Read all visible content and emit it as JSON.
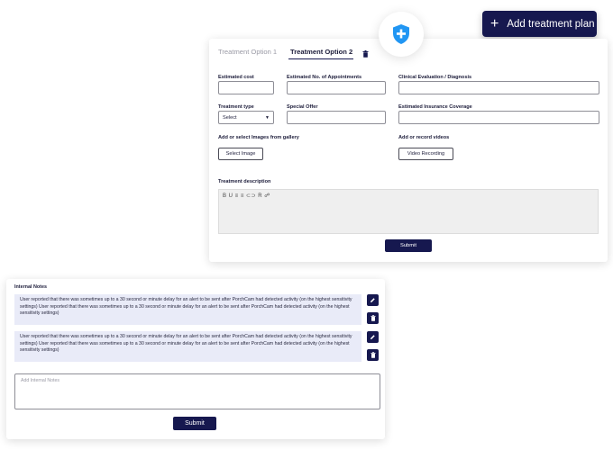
{
  "header": {
    "add_plan_label": "Add treatment plan"
  },
  "tabs": [
    {
      "label": "Treatment Option 1"
    },
    {
      "label": "Treatment Option 2"
    }
  ],
  "form": {
    "estimated_cost_label": "Estimated cost",
    "appointments_label": "Estimated No. of Appointments",
    "clinical_label": "Clinical Evaluation / Diagnosis",
    "treatment_type_label": "Treatment type",
    "treatment_type_value": "Select",
    "special_offer_label": "Special Offer",
    "insurance_label": "Estimated Insurance Coverage",
    "images_label": "Add or select Images from gallery",
    "select_image_button": "Select Image",
    "videos_label": "Add or record videos",
    "video_button": "Video Recording",
    "description_label": "Treatment description",
    "toolbar_glyphs": "B U ≡ ≡ ⊂⊃ R ☍",
    "submit_label": "Submit"
  },
  "notes": {
    "title": "Internal Notes",
    "items": [
      {
        "text": "User reported that there was sometimes up to a 30 second or minute delay for an alert to be sent after PorchCam had detected activity (on the highest sensitivity settings) User reported that there was sometimes up to a 30 second or minute delay for an alert to be sent after PorchCam had detected activity (on the highest sensitivity settings)"
      },
      {
        "text": "User reported that there was sometimes up to a 30 second or minute delay for an alert to be sent after PorchCam had detected activity (on the highest sensitivity settings) User reported that there was sometimes up to a 30 second or minute delay for an alert to be sent after PorchCam had detected activity (on the highest sensitivity settings)"
      }
    ],
    "placeholder": "Add Internal Notes",
    "submit_label": "Submit"
  },
  "colors": {
    "primary": "#16184f",
    "shield": "#2196f3",
    "note_bg": "#e9ebf8"
  }
}
